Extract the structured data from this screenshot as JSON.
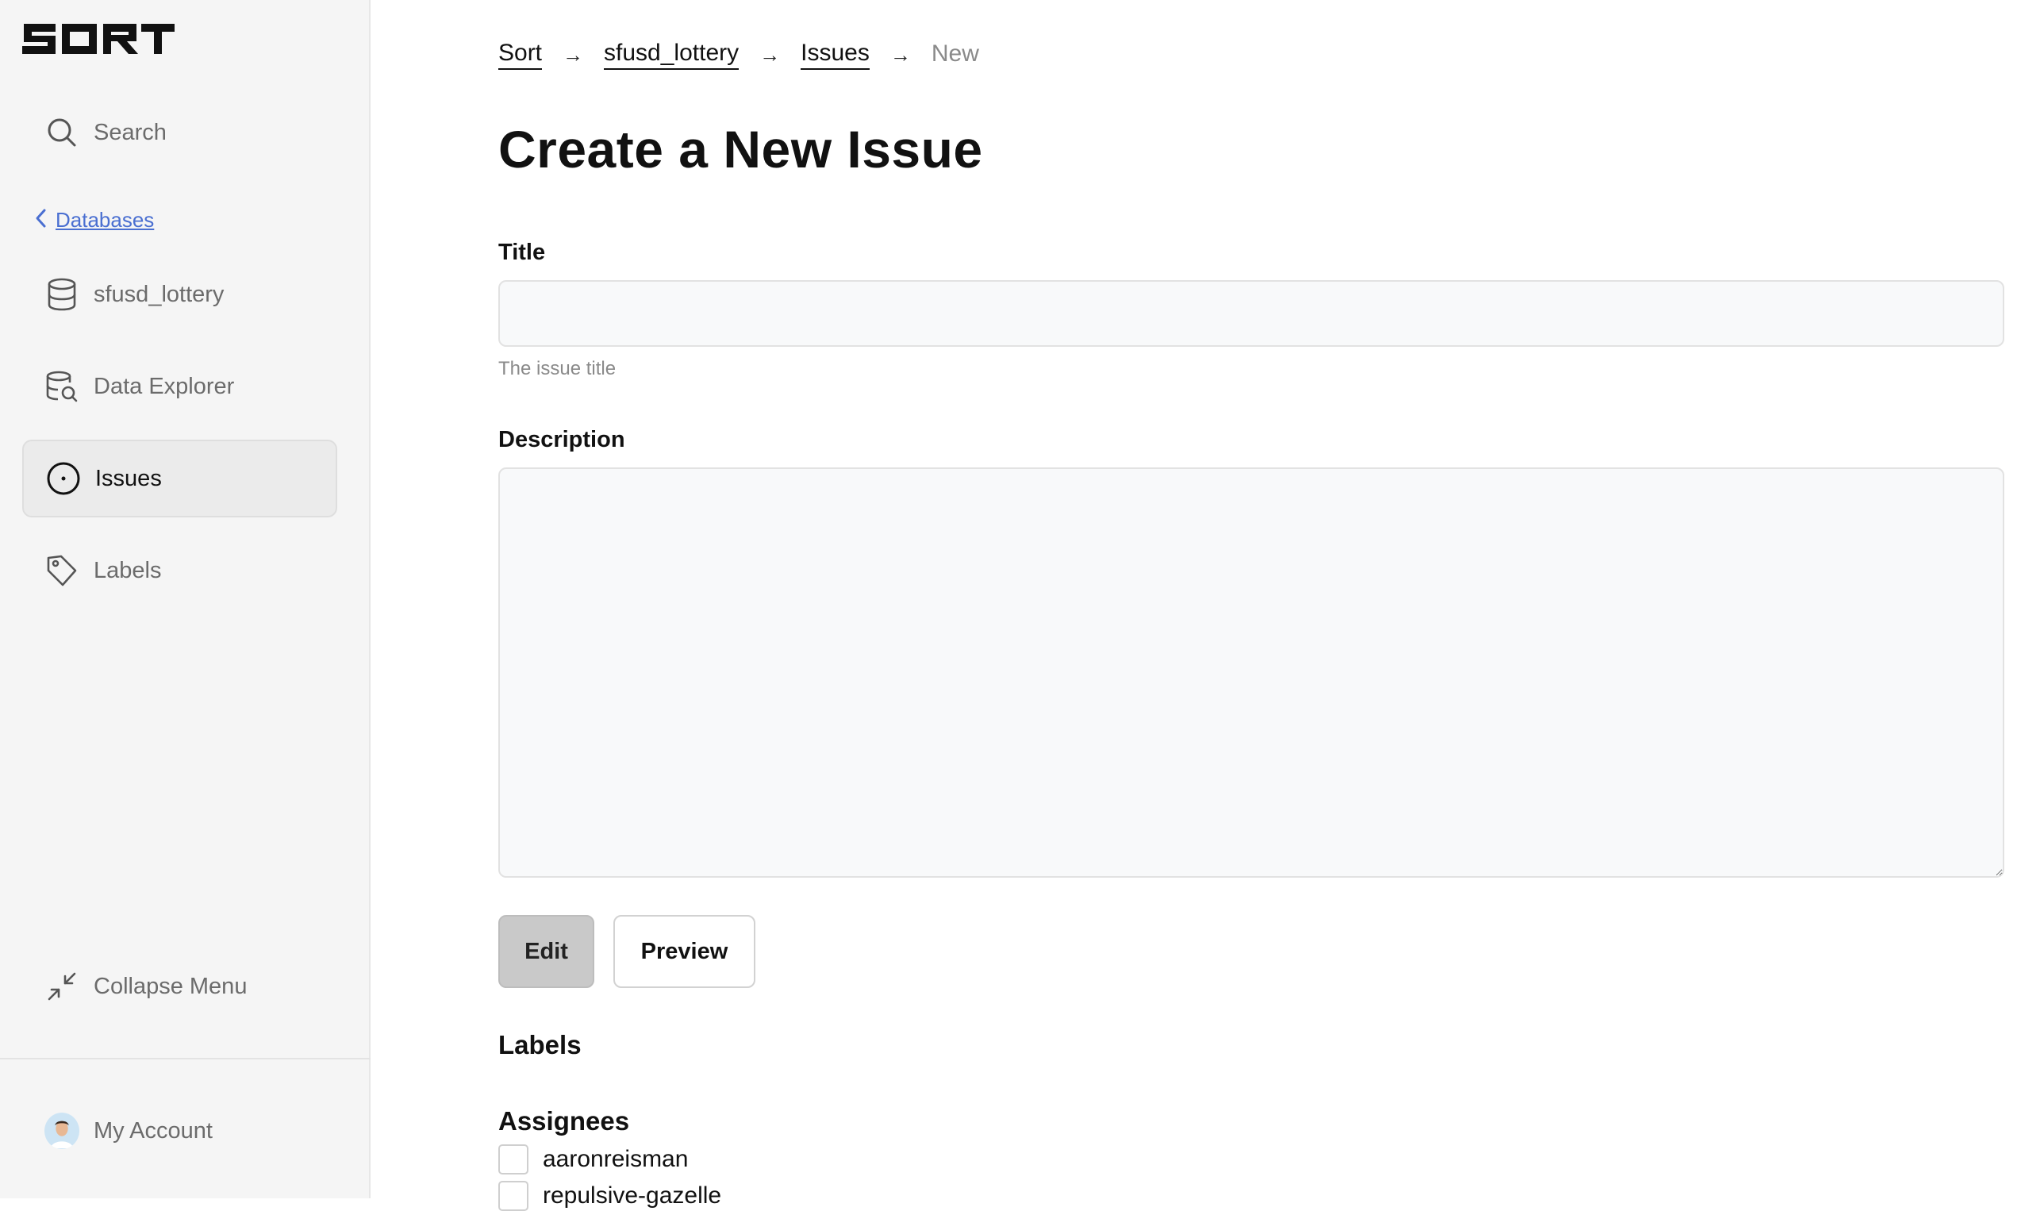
{
  "sidebar": {
    "logo": "SORT",
    "search_label": "Search",
    "back_label": "Databases",
    "items": [
      {
        "label": "sfusd_lottery",
        "icon": "database-icon"
      },
      {
        "label": "Data Explorer",
        "icon": "database-search-icon"
      },
      {
        "label": "Issues",
        "icon": "issue-circle-icon",
        "active": true
      },
      {
        "label": "Labels",
        "icon": "tag-icon"
      }
    ],
    "collapse_label": "Collapse Menu",
    "account_label": "My Account"
  },
  "breadcrumb": {
    "items": [
      "Sort",
      "sfusd_lottery",
      "Issues"
    ],
    "current": "New",
    "separator": "→"
  },
  "page": {
    "title": "Create a New Issue",
    "title_field": {
      "label": "Title",
      "value": "",
      "help": "The issue title"
    },
    "description_field": {
      "label": "Description",
      "value": ""
    },
    "buttons": {
      "edit": "Edit",
      "preview": "Preview"
    },
    "labels_heading": "Labels",
    "assignees_heading": "Assignees",
    "assignees": [
      "aaronreisman",
      "repulsive-gazelle"
    ]
  },
  "colors": {
    "link": "#4a6fd1",
    "sidebar_bg": "#f5f5f5",
    "active_item_bg": "#ebebeb",
    "input_bg": "#f8f9fa"
  }
}
